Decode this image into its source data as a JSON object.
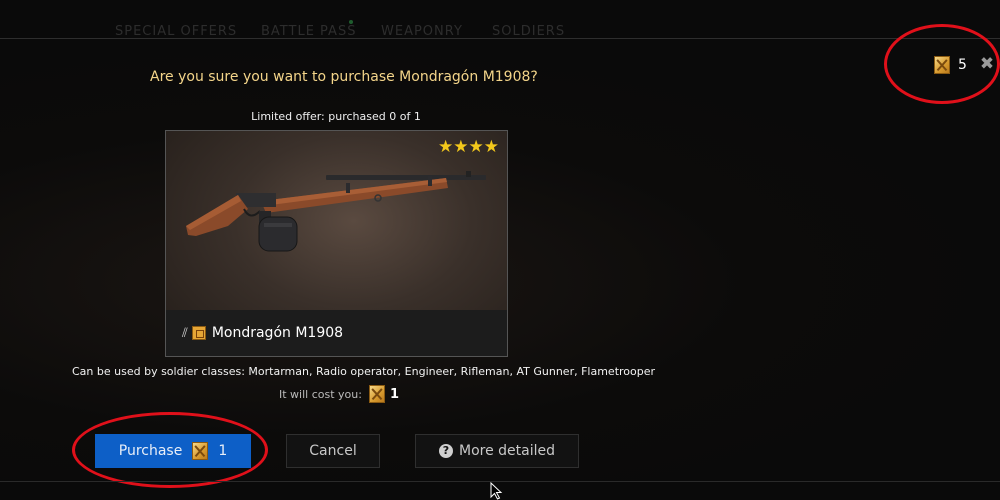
{
  "nav": {
    "items": [
      "SPECIAL OFFERS",
      "BATTLE PASS",
      "WEAPONRY",
      "SOLDIERS"
    ]
  },
  "currency": {
    "icon": "ticket-icon",
    "value": "5"
  },
  "close": {
    "icon": "close-icon",
    "glyph": "✖"
  },
  "dialog": {
    "question": "Are you sure you want to purchase Mondragón M1908?",
    "limited": "Limited offer: purchased 0 of 1",
    "item": {
      "name": "Mondragón M1908",
      "stars": "★★★★",
      "rating": 4,
      "icons": [
        "ammo-icon",
        "rank-icon"
      ]
    },
    "classes_text": "Can be used by soldier classes: Mortarman, Radio operator, Engineer, Rifleman, AT Gunner, Flametrooper",
    "cost_label": "It will cost you:",
    "cost_value": "1"
  },
  "buttons": {
    "purchase_label": "Purchase",
    "purchase_cost": "1",
    "cancel_label": "Cancel",
    "more_label": "More detailed",
    "more_icon_glyph": "?"
  },
  "colors": {
    "accent": "#0d5fc7",
    "title_text": "#f4d58a",
    "star": "#f3c81b",
    "annotation": "#e0101a"
  }
}
